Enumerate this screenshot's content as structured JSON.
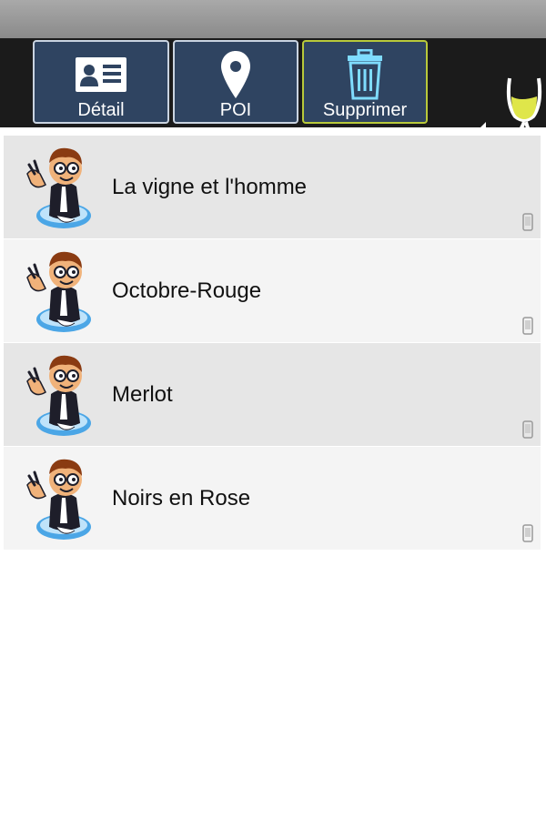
{
  "toolbar": {
    "buttons": [
      {
        "label": "Détail",
        "icon": "id-card-icon"
      },
      {
        "label": "POI",
        "icon": "map-pin-icon"
      },
      {
        "label": "Supprimer",
        "icon": "trash-icon",
        "selected": true
      }
    ],
    "back_icon": "back-arrow-wine-glass-icon"
  },
  "list": {
    "items": [
      {
        "title": "La vigne et l'homme",
        "avatar": "sommelier-mascot-icon",
        "badge_icon": "phone-icon"
      },
      {
        "title": "Octobre-Rouge",
        "avatar": "sommelier-mascot-icon",
        "badge_icon": "phone-icon"
      },
      {
        "title": "Merlot",
        "avatar": "sommelier-mascot-icon",
        "badge_icon": "phone-icon"
      },
      {
        "title": "Noirs en Rose",
        "avatar": "sommelier-mascot-icon",
        "badge_icon": "phone-icon"
      }
    ]
  },
  "colors": {
    "toolbar_bg": "#1b1b1b",
    "button_bg": "#2f4461",
    "button_border": "#c9d3e0",
    "selected_border": "#b8c93a",
    "row_even": "#e6e6e6",
    "row_odd": "#f4f4f4"
  }
}
